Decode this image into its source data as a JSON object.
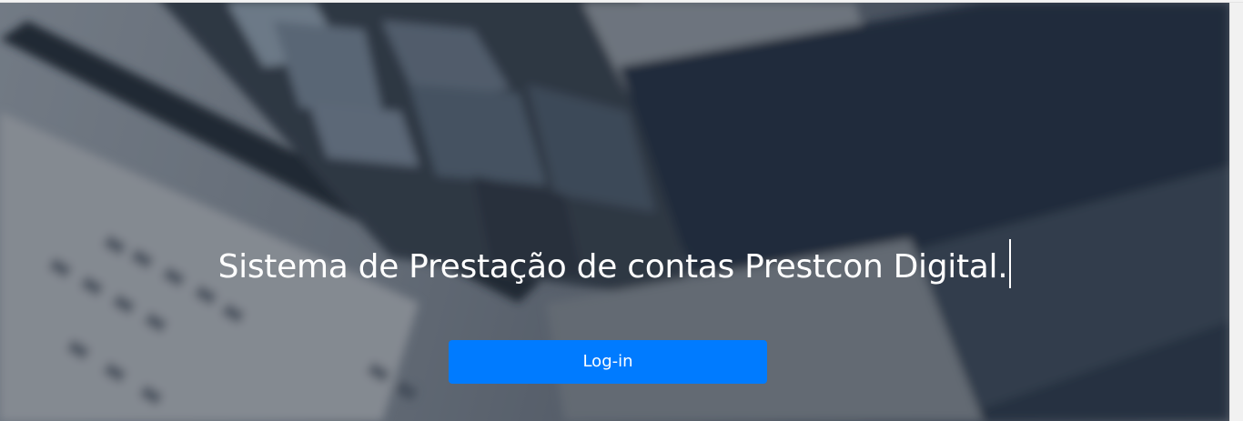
{
  "hero": {
    "title": "Sistema de Prestação de contas Prestcon Digital.",
    "background_icon": "calculator-and-spreadsheet-photo",
    "login_label": "Log-in"
  },
  "colors": {
    "button_primary": "#007bff",
    "title_text": "#ffffff",
    "overlay": "#262d38"
  }
}
